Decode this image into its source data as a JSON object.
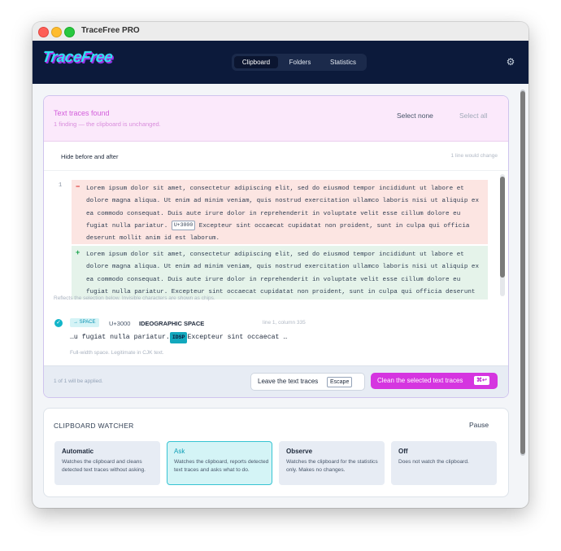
{
  "window": {
    "title": "TraceFree PRO"
  },
  "app": {
    "logo": "TraceFree"
  },
  "nav": {
    "tabs": [
      "Clipboard",
      "Folders",
      "Statistics"
    ],
    "active": "Clipboard"
  },
  "icons": {
    "settings": "gear-icon",
    "check": "check-circle-icon"
  },
  "colors": {
    "accent": "#d535e0",
    "navbar": "#0c1a3b",
    "teal": "#12b5c9"
  },
  "traces": {
    "title": "Text traces found",
    "subtitle": "1 finding — the clipboard is unchanged.",
    "select_none": "Select none",
    "select_all": "Select all",
    "hide_toggle": "Hide before and after",
    "line_change": "1 line would change",
    "line_number": "1",
    "diff": {
      "del_mark": "−",
      "add_mark": "+",
      "before_part1": "Lorem ipsum dolor sit amet, consectetur adipiscing elit, sed do eiusmod tempor incididunt ut labore et dolore magna aliqua. Ut enim ad minim veniam, quis nostrud exercitation ullamco laboris nisi ut aliquip ex ea commodo consequat. Duis aute irure dolor in reprehenderit in voluptate velit esse cillum dolore eu fugiat nulla pariatur.",
      "chip": "U+3000",
      "before_part2": "Excepteur sint occaecat cupidatat non proident, sunt in culpa qui officia deserunt mollit anim id est laborum.",
      "after": "Lorem ipsum dolor sit amet, consectetur adipiscing elit, sed do eiusmod tempor incididunt ut labore et dolore magna aliqua. Ut enim ad minim veniam, quis nostrud exercitation ullamco laboris nisi ut aliquip ex ea commodo consequat. Duis aute irure dolor in reprehenderit in voluptate velit esse cillum dolore eu fugiat nulla pariatur. Excepteur sint occaecat cupidatat non proident, sunt in culpa qui officia deserunt mollit anim id est laborum."
    },
    "reflects_note": "Reflects the selection below. Invisible characters are shown as chips.",
    "finding": {
      "chip": "→ SPACE",
      "code": "U+3000",
      "name": "IDEOGRAPHIC SPACE",
      "location": "line 1, column 335",
      "snippet_before": "…u fugiat nulla pariatur.",
      "snippet_chip": "IDSP",
      "snippet_after": "Excepteur sint occaecat …",
      "note": "Full-width space. Legitimate in CJK text."
    },
    "applied": "1 of 1 will be applied.",
    "leave_button": "Leave the text traces",
    "leave_key": "Escape",
    "clean_button": "Clean the selected text traces",
    "clean_key": "⌘↩"
  },
  "watcher": {
    "title": "CLIPBOARD WATCHER",
    "pause": "Pause",
    "selected": "Ask",
    "modes": [
      {
        "title": "Automatic",
        "desc": "Watches the clipboard and cleans detected text traces without asking."
      },
      {
        "title": "Ask",
        "desc": "Watches the clipboard, reports detected text traces and asks what to do."
      },
      {
        "title": "Observe",
        "desc": "Watches the clipboard for the statistics only. Makes no changes."
      },
      {
        "title": "Off",
        "desc": "Does not watch the clipboard."
      }
    ]
  }
}
